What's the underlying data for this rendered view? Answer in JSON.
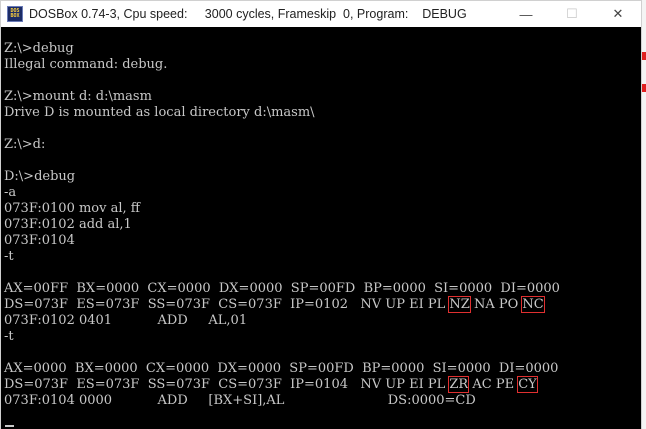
{
  "window": {
    "app_icon_line1": "DOS",
    "app_icon_line2": "BOX",
    "title": "DOSBox 0.74-3, Cpu speed:     3000 cycles, Frameskip  0, Program:    DEBUG",
    "minimize_glyph": "—",
    "maximize_glyph": "☐",
    "close_glyph": "✕"
  },
  "console": {
    "lines": [
      "Z:\\>debug",
      "Illegal command: debug.",
      "",
      "Z:\\>mount d: d:\\masm",
      "Drive D is mounted as local directory d:\\masm\\",
      "",
      "Z:\\>d:",
      "",
      "D:\\>debug",
      "-a",
      "073F:0100 mov al, ff",
      "073F:0102 add al,1",
      "073F:0104",
      "-t",
      "",
      "AX=00FF  BX=0000  CX=0000  DX=0000  SP=00FD  BP=0000  SI=0000  DI=0000",
      {
        "segs": [
          "DS=073F  ES=073F  SS=073F  CS=073F  IP=0102   NV UP EI PL ",
          "NZ",
          " NA PO ",
          "NC"
        ]
      },
      "073F:0102 0401           ADD     AL,01",
      "-t",
      "",
      "AX=0000  BX=0000  CX=0000  DX=0000  SP=00FD  BP=0000  SI=0000  DI=0000",
      {
        "segs": [
          "DS=073F  ES=073F  SS=073F  CS=073F  IP=0104   NV UP EI PL ",
          "ZR",
          " AC PE ",
          "CY"
        ]
      },
      "073F:0104 0000           ADD     [BX+SI],AL                         DS:0000=CD"
    ]
  },
  "colors": {
    "console_bg": "#000000",
    "console_text": "#c8c8c8",
    "highlight_box": "#e03030"
  }
}
